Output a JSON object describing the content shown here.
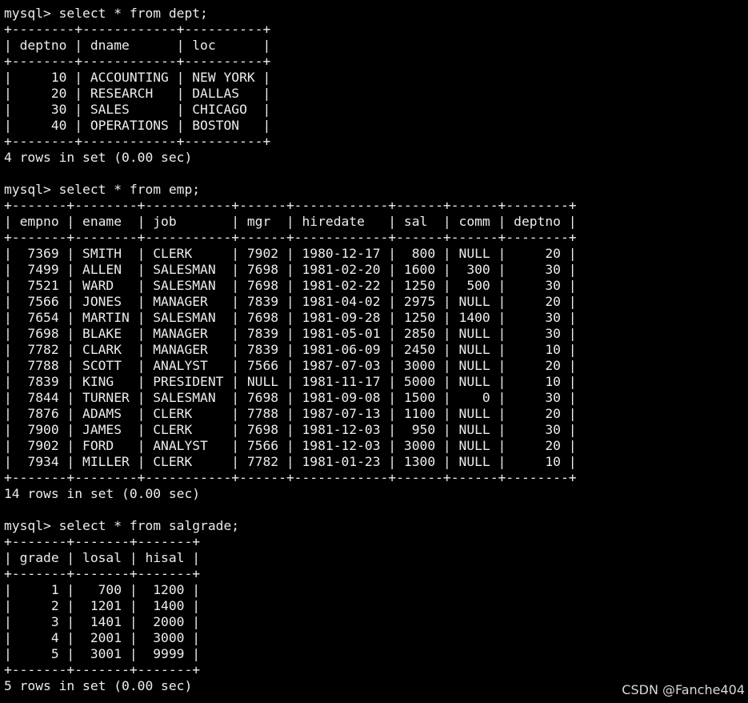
{
  "terminal": {
    "lines": [
      "mysql> select * from dept;",
      "+--------+------------+----------+",
      "| deptno | dname      | loc      |",
      "+--------+------------+----------+",
      "|     10 | ACCOUNTING | NEW YORK |",
      "|     20 | RESEARCH   | DALLAS   |",
      "|     30 | SALES      | CHICAGO  |",
      "|     40 | OPERATIONS | BOSTON   |",
      "+--------+------------+----------+",
      "4 rows in set (0.00 sec)",
      "",
      "mysql> select * from emp;",
      "+-------+--------+-----------+------+------------+------+------+--------+",
      "| empno | ename  | job       | mgr  | hiredate   | sal  | comm | deptno |",
      "+-------+--------+-----------+------+------------+------+------+--------+",
      "|  7369 | SMITH  | CLERK     | 7902 | 1980-12-17 |  800 | NULL |     20 |",
      "|  7499 | ALLEN  | SALESMAN  | 7698 | 1981-02-20 | 1600 |  300 |     30 |",
      "|  7521 | WARD   | SALESMAN  | 7698 | 1981-02-22 | 1250 |  500 |     30 |",
      "|  7566 | JONES  | MANAGER   | 7839 | 1981-04-02 | 2975 | NULL |     20 |",
      "|  7654 | MARTIN | SALESMAN  | 7698 | 1981-09-28 | 1250 | 1400 |     30 |",
      "|  7698 | BLAKE  | MANAGER   | 7839 | 1981-05-01 | 2850 | NULL |     30 |",
      "|  7782 | CLARK  | MANAGER   | 7839 | 1981-06-09 | 2450 | NULL |     10 |",
      "|  7788 | SCOTT  | ANALYST   | 7566 | 1987-07-03 | 3000 | NULL |     20 |",
      "|  7839 | KING   | PRESIDENT | NULL | 1981-11-17 | 5000 | NULL |     10 |",
      "|  7844 | TURNER | SALESMAN  | 7698 | 1981-09-08 | 1500 |    0 |     30 |",
      "|  7876 | ADAMS  | CLERK     | 7788 | 1987-07-13 | 1100 | NULL |     20 |",
      "|  7900 | JAMES  | CLERK     | 7698 | 1981-12-03 |  950 | NULL |     30 |",
      "|  7902 | FORD   | ANALYST   | 7566 | 1981-12-03 | 3000 | NULL |     20 |",
      "|  7934 | MILLER | CLERK     | 7782 | 1981-01-23 | 1300 | NULL |     10 |",
      "+-------+--------+-----------+------+------------+------+------+--------+",
      "14 rows in set (0.00 sec)",
      "",
      "mysql> select * from salgrade;",
      "+-------+-------+-------+",
      "| grade | losal | hisal |",
      "+-------+-------+-------+",
      "|     1 |   700 |  1200 |",
      "|     2 |  1201 |  1400 |",
      "|     3 |  1401 |  2000 |",
      "|     4 |  2001 |  3000 |",
      "|     5 |  3001 |  9999 |",
      "+-------+-------+-------+",
      "5 rows in set (0.00 sec)"
    ]
  },
  "watermark": {
    "text": "CSDN @Fanche404"
  },
  "colors": {
    "background": "#000000",
    "text": "#ececec"
  }
}
